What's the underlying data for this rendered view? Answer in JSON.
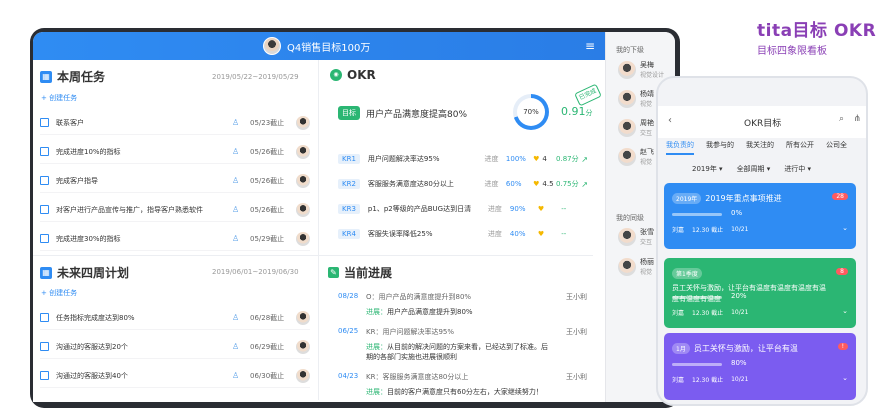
{
  "brand": {
    "logo_text": "tita目标 OKR",
    "subtitle": "目标四象限看板",
    "tag": "tita"
  },
  "topbar": {
    "title": "Q4销售目标100万"
  },
  "weekly": {
    "title": "本周任务",
    "date": "2019/05/22~2019/05/29",
    "add": "+ 创建任务",
    "tasks": [
      {
        "label": "联系客户",
        "due": "05/23截止"
      },
      {
        "label": "完成进度10%的指标",
        "due": "05/26截止"
      },
      {
        "label": "完成客户指导",
        "due": "05/26截止"
      },
      {
        "label": "对客户进行产品宣传与推广，指导客户熟悉软件",
        "due": "05/26截止"
      },
      {
        "label": "完成进度30%的指标",
        "due": "05/29截止"
      }
    ]
  },
  "future": {
    "title": "未来四周计划",
    "date": "2019/06/01~2019/06/30",
    "add": "+ 创建任务",
    "tasks": [
      {
        "label": "任务指标完成度达到80%",
        "due": "06/28截止"
      },
      {
        "label": "沟通过的客服达到20个",
        "due": "06/29截止"
      },
      {
        "label": "沟通过的客服达到40个",
        "due": "06/30截止"
      }
    ]
  },
  "okr": {
    "title": "OKR",
    "objective_tag": "目标",
    "objective": "用户产品满意度提高80%",
    "progress": "70%",
    "score": "0.91",
    "score_unit": "分",
    "stamp": "已完成",
    "krs": [
      {
        "tag": "KR1",
        "label": "用户问题解决率达95%",
        "prog_label": "进度",
        "prog": "100%",
        "conf": "4",
        "score": "0.87分"
      },
      {
        "tag": "KR2",
        "label": "客服服务满意度达80分以上",
        "prog_label": "进度",
        "prog": "60%",
        "conf": "4.5",
        "score": "0.75分"
      },
      {
        "tag": "KR3",
        "label": "p1、p2等级的产品BUG达到日清",
        "prog_label": "进度",
        "prog": "90%",
        "conf": "",
        "score": "--"
      },
      {
        "tag": "KR4",
        "label": "客服失误率降低25%",
        "prog_label": "进度",
        "prog": "40%",
        "conf": "",
        "score": "--"
      }
    ]
  },
  "progress": {
    "title": "当前进展",
    "items": [
      {
        "date": "08/28",
        "title": "O：用户产品的满意度提升到80%",
        "note_label": "进展：",
        "note": "用户产品满意度提升到80%",
        "user": "王小利"
      },
      {
        "date": "06/25",
        "title": "KR：用户问题解决率达95%",
        "note_label": "进展：",
        "note": "从目前的解决问题的方案来看，已经达到了标准。后期的各部门实施也进展很顺利",
        "user": "王小利"
      },
      {
        "date": "04/23",
        "title": "KR：客服服务满意度达80分以上",
        "note_label": "进展：",
        "note": "目前的客户满意度只有60分左右，大家继续努力！",
        "user": "王小利"
      }
    ]
  },
  "sidebar": {
    "subordinates_title": "我的下级",
    "colleagues_title": "我的同级",
    "people": [
      {
        "name": "吴梅",
        "role": "视觉设计"
      },
      {
        "name": "杨靖",
        "role": "视觉"
      },
      {
        "name": "周艳",
        "role": "交互"
      },
      {
        "name": "赵飞",
        "role": "视觉"
      }
    ],
    "colleagues": [
      {
        "name": "张雪",
        "role": "交互"
      },
      {
        "name": "杨丽",
        "role": "视觉"
      }
    ]
  },
  "phone": {
    "title": "OKR目标",
    "tabs": [
      "我负责的",
      "我参与的",
      "我关注的",
      "所有公开",
      "公司全"
    ],
    "filters": [
      "2019年 ▾",
      "全部周期 ▾",
      "进行中 ▾"
    ],
    "cards": [
      {
        "tag": "2019年",
        "title": "2019年重点事项推进",
        "badge": "28",
        "pct": "0%",
        "owner": "刘嘉",
        "time": "12.30 截止",
        "tasks": "10/21",
        "color": "#2f8cf3"
      },
      {
        "tag": "第1季度",
        "title": "员工关怀与激励，让平台有温度有温度有温度有温度有温度有温度",
        "badge": "8",
        "pct": "20%",
        "owner": "刘嘉",
        "time": "12.30 截止",
        "tasks": "10/21",
        "color": "#2bb673"
      },
      {
        "tag": "1月",
        "title": "员工关怀与激励，让平台有温",
        "badge": "!",
        "pct": "80%",
        "owner": "刘嘉",
        "time": "12.30 截止",
        "tasks": "10/21",
        "color": "#7b5cf0"
      }
    ]
  }
}
